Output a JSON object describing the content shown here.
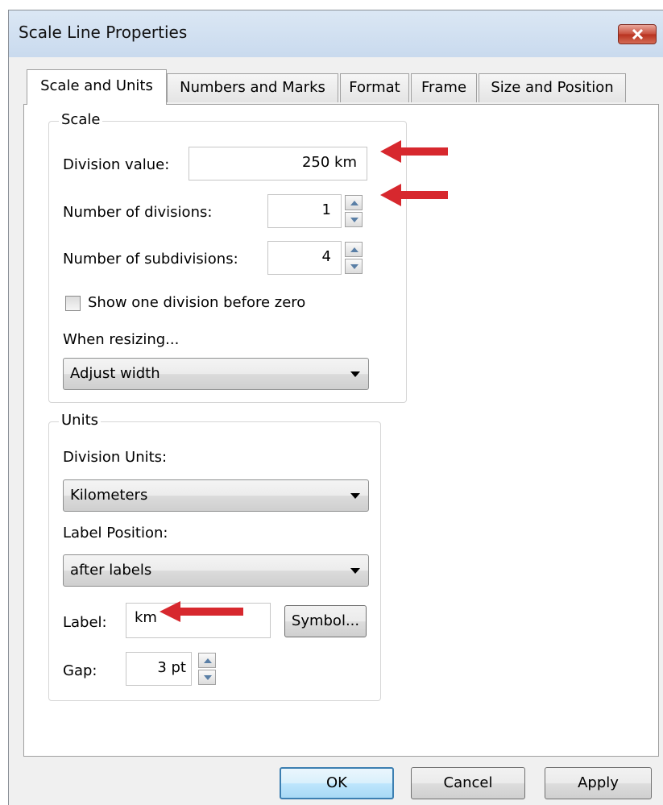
{
  "window": {
    "title": "Scale Line Properties"
  },
  "tabs": [
    {
      "label": "Scale and Units",
      "active": true
    },
    {
      "label": "Numbers and Marks",
      "active": false
    },
    {
      "label": "Format",
      "active": false
    },
    {
      "label": "Frame",
      "active": false
    },
    {
      "label": "Size and Position",
      "active": false
    }
  ],
  "scale": {
    "group_label": "Scale",
    "division_value_label": "Division value:",
    "division_value": "250 km",
    "num_divisions_label": "Number of divisions:",
    "num_divisions": "1",
    "num_subdivisions_label": "Number of subdivisions:",
    "num_subdivisions": "4",
    "show_division_before_zero_label": "Show one division before zero",
    "show_division_before_zero_checked": false,
    "when_resizing_label": "When resizing...",
    "when_resizing_value": "Adjust width"
  },
  "units": {
    "group_label": "Units",
    "division_units_label": "Division Units:",
    "division_units_value": "Kilometers",
    "label_position_label": "Label Position:",
    "label_position_value": "after labels",
    "label_label": "Label:",
    "label_value": "km",
    "symbol_button": "Symbol...",
    "gap_label": "Gap:",
    "gap_value": "3 pt"
  },
  "buttons": {
    "ok": "OK",
    "cancel": "Cancel",
    "apply": "Apply"
  },
  "icons": {
    "close": "close-icon",
    "spin_up": "chevron-up-icon",
    "spin_down": "chevron-down-icon",
    "dropdown": "dropdown-arrow-icon",
    "annotation_arrow": "left-arrow-icon"
  },
  "colors": {
    "annotation_arrow": "#d7282e",
    "titlebar": "#c9daee",
    "default_button_border": "#3c7fb1"
  }
}
